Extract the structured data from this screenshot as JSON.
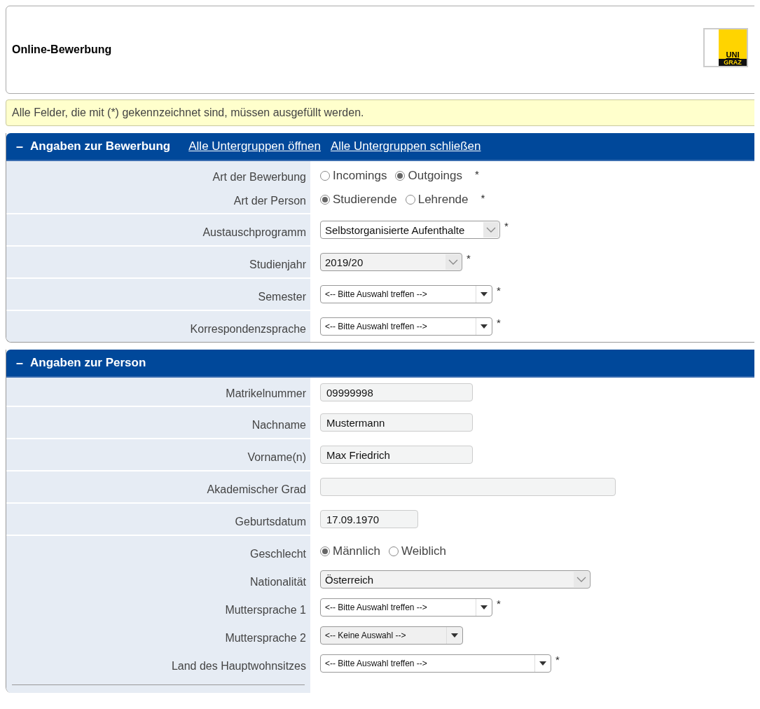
{
  "header": {
    "title": "Online-Bewerbung",
    "logo": {
      "line_1": "UNI",
      "line_2": "GRAZ"
    }
  },
  "notice": "Alle Felder, die mit (*) gekennzeichnet sind, müssen ausgefüllt werden.",
  "sections": [
    {
      "toggle": "–",
      "title": "Angaben zur Bewerbung",
      "expanded": true,
      "links": [
        "Alle Untergruppen öffnen",
        "Alle Untergruppen schließen"
      ],
      "groups": [
        {
          "rows": [
            {
              "label": "Art der Bewerbung",
              "kind": "radio",
              "required_mark": "*",
              "options": [
                {
                  "label": "Incomings",
                  "selected": false
                },
                {
                  "label": "Outgoings",
                  "selected": true
                }
              ]
            },
            {
              "label": "Art der Person",
              "kind": "radio",
              "required_mark": "*",
              "options": [
                {
                  "label": "Studierende",
                  "selected": true
                },
                {
                  "label": "Lehrende",
                  "selected": false
                }
              ]
            }
          ]
        },
        {
          "rows": [
            {
              "label": "Austauschprogramm",
              "kind": "select",
              "disabled": false,
              "value": "Selbstorganisierte Aufenthalte",
              "required_mark": "*"
            }
          ]
        },
        {
          "rows": [
            {
              "label": "Studienjahr",
              "kind": "select",
              "disabled": true,
              "value": "2019/20",
              "required_mark": "*"
            }
          ]
        },
        {
          "rows": [
            {
              "label": "Semester",
              "kind": "combo",
              "disabled": false,
              "value": "<-- Bitte Auswahl treffen -->",
              "required_mark": "*"
            }
          ]
        },
        {
          "rows": [
            {
              "label": "Korrespondenzsprache",
              "kind": "combo",
              "disabled": false,
              "value": "<-- Bitte Auswahl treffen -->",
              "required_mark": "*"
            }
          ]
        }
      ]
    },
    {
      "toggle": "–",
      "title": "Angaben zur Person",
      "expanded": true,
      "groups": [
        {
          "rows": [
            {
              "label": "Matrikelnummer",
              "kind": "text",
              "value": "09999998"
            }
          ]
        },
        {
          "rows": [
            {
              "label": "Nachname",
              "kind": "text",
              "value": "Mustermann"
            }
          ]
        },
        {
          "rows": [
            {
              "label": "Vorname(n)",
              "kind": "text",
              "value": "Max Friedrich"
            }
          ]
        },
        {
          "rows": [
            {
              "label": "Akademischer Grad",
              "kind": "text",
              "value": ""
            }
          ]
        },
        {
          "rows": [
            {
              "label": "Geburtsdatum",
              "kind": "text",
              "value": "17.09.1970"
            }
          ]
        },
        {
          "rows": [
            {
              "label": "Geschlecht",
              "kind": "radio",
              "options": [
                {
                  "label": "Männlich",
                  "selected": true
                },
                {
                  "label": "Weiblich",
                  "selected": false
                }
              ]
            },
            {
              "label": "Nationalität",
              "kind": "select",
              "disabled": true,
              "value": "Österreich"
            },
            {
              "label": "Muttersprache 1",
              "kind": "combo",
              "disabled": false,
              "value": "<-- Bitte Auswahl treffen -->",
              "required_mark": "*"
            },
            {
              "label": "Muttersprache 2",
              "kind": "combo",
              "disabled": true,
              "value": "<-- Keine Auswahl -->"
            },
            {
              "label": "Land des Hauptwohnsitzes",
              "kind": "combo",
              "disabled": false,
              "value": "<-- Bitte Auswahl treffen -->",
              "required_mark": "*"
            }
          ]
        }
      ]
    }
  ]
}
